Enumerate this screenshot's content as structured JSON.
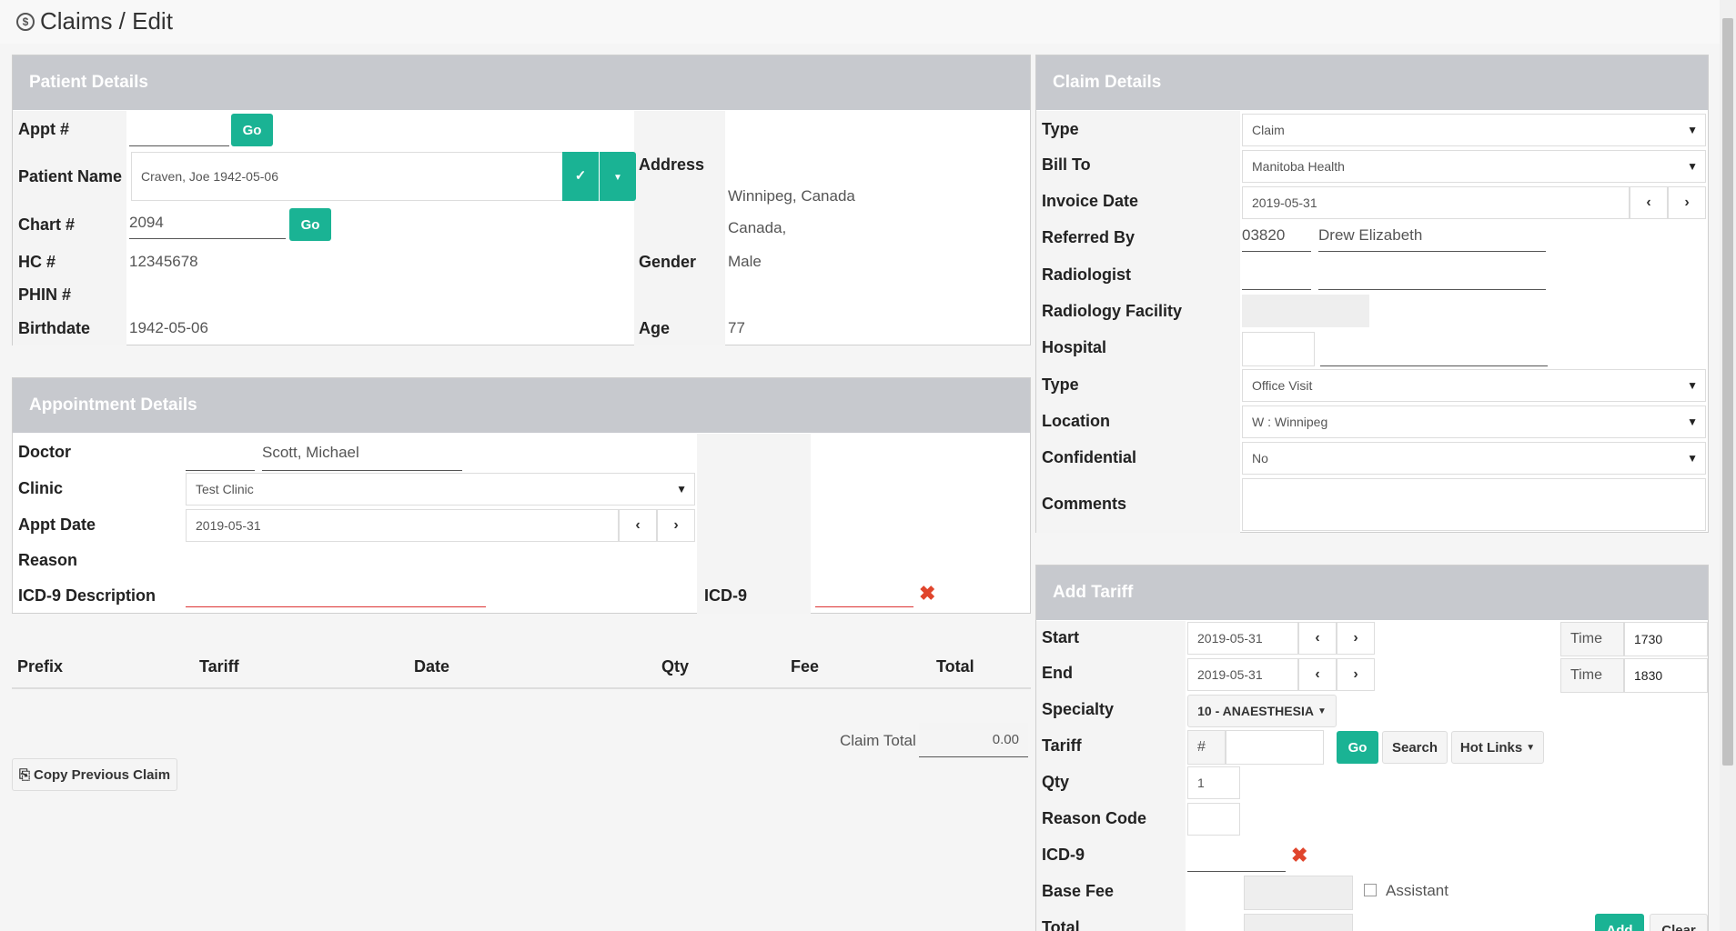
{
  "page": {
    "title": "Claims / Edit"
  },
  "patient": {
    "header": "Patient Details",
    "appt_label": "Appt #",
    "appt_value": "",
    "go": "Go",
    "name_label": "Patient Name",
    "name_value": "Craven, Joe 1942-05-06",
    "chart_label": "Chart #",
    "chart_value": "2094",
    "hc_label": "HC #",
    "hc_value": "12345678",
    "phin_label": "PHIN #",
    "phin_value": "",
    "birthdate_label": "Birthdate",
    "birthdate_value": "1942-05-06",
    "address_label": "Address",
    "address_line1": "Winnipeg, Canada",
    "address_line2": "Canada,",
    "gender_label": "Gender",
    "gender_value": "Male",
    "age_label": "Age",
    "age_value": "77"
  },
  "appointment": {
    "header": "Appointment Details",
    "doctor_label": "Doctor",
    "doctor_value": "Scott, Michael",
    "clinic_label": "Clinic",
    "clinic_value": "Test Clinic",
    "appt_date_label": "Appt Date",
    "appt_date_value": "2019-05-31",
    "reason_label": "Reason",
    "icd9_desc_label": "ICD-9 Description",
    "icd9_label": "ICD-9"
  },
  "table": {
    "columns": [
      "Prefix",
      "Tariff",
      "Date",
      "Qty",
      "Fee",
      "Total"
    ],
    "claim_total_label": "Claim Total",
    "claim_total_value": "0.00",
    "copy_previous": "Copy Previous Claim"
  },
  "claim": {
    "header": "Claim Details",
    "type_label": "Type",
    "type_value": "Claim",
    "bill_to_label": "Bill To",
    "bill_to_value": "Manitoba Health",
    "invoice_date_label": "Invoice Date",
    "invoice_date_value": "2019-05-31",
    "referred_by_label": "Referred By",
    "referred_by_code": "03820",
    "referred_by_name": "Drew Elizabeth",
    "radiologist_label": "Radiologist",
    "radiology_facility_label": "Radiology Facility",
    "hospital_label": "Hospital",
    "visit_type_label": "Type",
    "visit_type_value": "Office Visit",
    "location_label": "Location",
    "location_value": "W : Winnipeg",
    "confidential_label": "Confidential",
    "confidential_value": "No",
    "comments_label": "Comments"
  },
  "tariff": {
    "header": "Add Tariff",
    "start_label": "Start",
    "start_value": "2019-05-31",
    "end_label": "End",
    "end_value": "2019-05-31",
    "time_label": "Time",
    "start_time": "1730",
    "end_time": "1830",
    "specialty_label": "Specialty",
    "specialty_value": "10 - ANAESTHESIA",
    "tariff_label": "Tariff",
    "hash": "#",
    "go": "Go",
    "search": "Search",
    "hot_links": "Hot Links",
    "qty_label": "Qty",
    "qty_value": "1",
    "reason_code_label": "Reason Code",
    "icd9_label": "ICD-9",
    "base_fee_label": "Base Fee",
    "assistant_label": "Assistant",
    "total_label": "Total",
    "add": "Add",
    "clear": "Clear"
  },
  "colors": {
    "accent": "#1ab394",
    "header_bg": "#c7c9ce",
    "error": "#e0452c"
  }
}
